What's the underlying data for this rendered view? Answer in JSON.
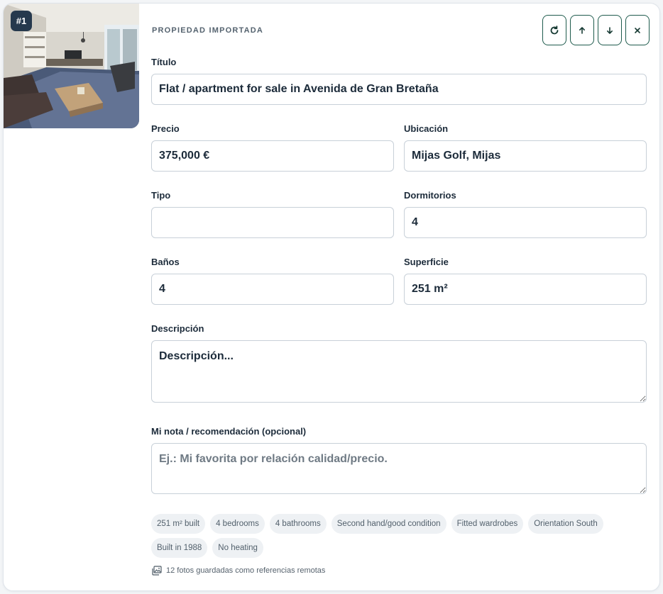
{
  "card": {
    "index_badge": "#1",
    "section_title": "PROPIEDAD IMPORTADA",
    "actions": {
      "refresh": "refresh-icon",
      "move_up": "arrow-up-icon",
      "move_down": "arrow-down-icon",
      "remove": "close-icon"
    }
  },
  "fields": {
    "title": {
      "label": "Título",
      "value": "Flat / apartment for sale in Avenida de Gran Bretaña"
    },
    "price": {
      "label": "Precio",
      "value": "375,000 €"
    },
    "location": {
      "label": "Ubicación",
      "value": "Mijas Golf, Mijas"
    },
    "type": {
      "label": "Tipo",
      "value": ""
    },
    "bedrooms": {
      "label": "Dormitorios",
      "value": "4"
    },
    "bathrooms": {
      "label": "Baños",
      "value": "4"
    },
    "area": {
      "label": "Superficie",
      "value": "251 m²"
    },
    "description": {
      "label": "Descripción",
      "placeholder": "Descripción..."
    },
    "note": {
      "label": "Mi nota / recomendación (opcional)",
      "placeholder": "Ej.: Mi favorita por relación calidad/precio."
    }
  },
  "features": [
    "251 m² built",
    "4 bedrooms",
    "4 bathrooms",
    "Second hand/good condition",
    "Fitted wardrobes",
    "Orientation South",
    "Built in 1988",
    "No heating"
  ],
  "photos_note": "12 fotos guardadas como referencias remotas",
  "colors": {
    "accent": "#1f5b4d",
    "badge": "#26394d",
    "chip_bg": "#eef1f4",
    "border": "#c8d0d8"
  }
}
